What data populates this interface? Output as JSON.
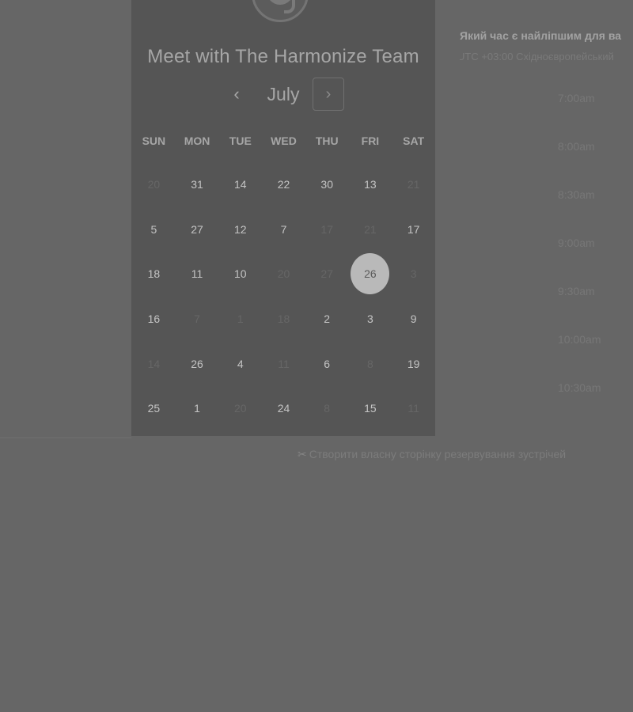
{
  "header": {
    "title": "Meet with The Harmonize Team"
  },
  "calendar": {
    "month": "July",
    "prev_icon": "chevron-left-icon",
    "next_icon": "chevron-right-icon",
    "prev_glyph": "‹",
    "next_glyph": "›",
    "weekdays": [
      "SUN",
      "MON",
      "TUE",
      "WED",
      "THU",
      "FRI",
      "SAT"
    ],
    "days": [
      {
        "label": "20",
        "muted": true
      },
      {
        "label": "31",
        "muted": false
      },
      {
        "label": "14",
        "muted": false
      },
      {
        "label": "22",
        "muted": false
      },
      {
        "label": "30",
        "muted": false
      },
      {
        "label": "13",
        "muted": false
      },
      {
        "label": "21",
        "muted": true
      },
      {
        "label": "5",
        "muted": false
      },
      {
        "label": "27",
        "muted": false
      },
      {
        "label": "12",
        "muted": false
      },
      {
        "label": "7",
        "muted": false
      },
      {
        "label": "17",
        "muted": true
      },
      {
        "label": "21",
        "muted": true
      },
      {
        "label": "17",
        "muted": false
      },
      {
        "label": "18",
        "muted": false
      },
      {
        "label": "11",
        "muted": false
      },
      {
        "label": "10",
        "muted": false
      },
      {
        "label": "20",
        "muted": true
      },
      {
        "label": "27",
        "muted": true
      },
      {
        "label": "26",
        "muted": false,
        "selected": true
      },
      {
        "label": "3",
        "muted": true
      },
      {
        "label": "16",
        "muted": false
      },
      {
        "label": "7",
        "muted": true
      },
      {
        "label": "1",
        "muted": true
      },
      {
        "label": "18",
        "muted": true
      },
      {
        "label": "2",
        "muted": false
      },
      {
        "label": "3",
        "muted": false
      },
      {
        "label": "9",
        "muted": false
      },
      {
        "label": "14",
        "muted": true
      },
      {
        "label": "26",
        "muted": false
      },
      {
        "label": "4",
        "muted": false
      },
      {
        "label": "11",
        "muted": true
      },
      {
        "label": "6",
        "muted": false
      },
      {
        "label": "8",
        "muted": true
      },
      {
        "label": "19",
        "muted": false
      },
      {
        "label": "25",
        "muted": false
      },
      {
        "label": "1",
        "muted": false
      },
      {
        "label": "20",
        "muted": true
      },
      {
        "label": "24",
        "muted": false
      },
      {
        "label": "8",
        "muted": true
      },
      {
        "label": "15",
        "muted": false
      },
      {
        "label": "11",
        "muted": true
      }
    ]
  },
  "time_panel": {
    "question": "Який час є найліпшим для ва",
    "timezone": "UTC +03:00 Східноєвропейський",
    "slots": [
      "7:00am",
      "8:00am",
      "8:30am",
      "9:00am",
      "9:30am",
      "10:00am",
      "10:30am"
    ]
  },
  "footer": {
    "link_icon": "scissors-icon",
    "link_glyph": "✂",
    "link_text": "Створити власну сторінку резервування зустрічей"
  },
  "colors": {
    "overlay_bg": "#666666",
    "panel_bg": "#555555",
    "selected_day": "#b9b9b9"
  }
}
